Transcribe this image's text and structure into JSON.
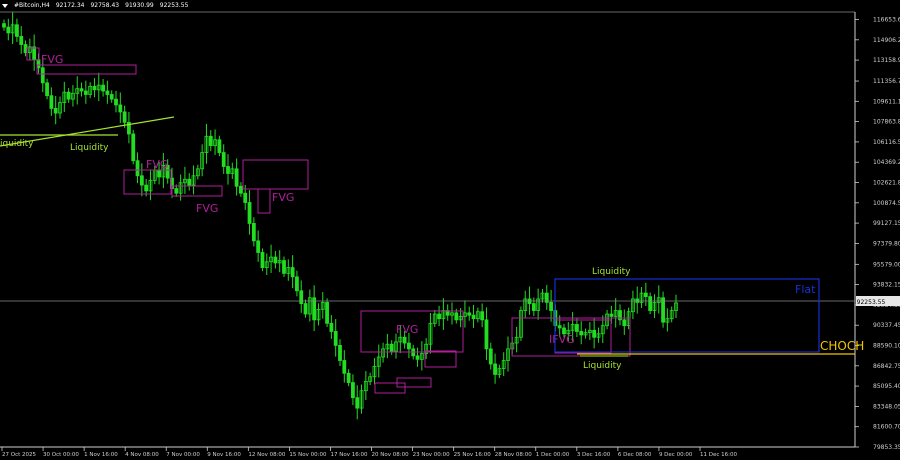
{
  "header": {
    "symbol": "#Bitcoin,H4",
    "open": "92172.34",
    "high": "92758.43",
    "low": "91930.99",
    "close": "92253.55"
  },
  "colors": {
    "background": "#000000",
    "candle": "#22dd22",
    "axis": "#cfcfcf",
    "fvg": "#b0209a",
    "liquidity": "#a6e22e",
    "flat": "#1730d8",
    "choch": "#f2c400",
    "price_line": "#8a8a8a"
  },
  "chart_data": {
    "type": "candlestick",
    "symbol": "#Bitcoin",
    "timeframe": "H4",
    "x_labels": [
      "27 Oct 2025",
      "30 Oct 00:00",
      "1 Nov 16:00",
      "4 Nov 08:00",
      "7 Nov 00:00",
      "9 Nov 16:00",
      "12 Nov 08:00",
      "15 Nov 00:00",
      "17 Nov 16:00",
      "20 Nov 08:00",
      "23 Nov 00:00",
      "25 Nov 16:00",
      "28 Nov 08:00",
      "1 Dec 00:00",
      "3 Dec 16:00",
      "6 Dec 08:00",
      "9 Dec 00:00",
      "11 Dec 16:00"
    ],
    "y_ticks": [
      "116653.60",
      "114906.25",
      "113158.90",
      "111356.70",
      "109611.15",
      "107863.80",
      "106116.55",
      "104369.20",
      "102621.85",
      "100874.50",
      "99127.15",
      "97379.80",
      "95579.00",
      "93832.15",
      "92084.80",
      "90337.45",
      "88590.10",
      "86842.75",
      "85095.40",
      "83348.05",
      "81600.70",
      "79853.35"
    ],
    "ylim": [
      79853.35,
      117300
    ],
    "current_price": "92253.55",
    "close_series": [
      116000,
      115500,
      116200,
      115200,
      114500,
      113800,
      114300,
      113200,
      112500,
      111200,
      110100,
      109000,
      108600,
      109500,
      110400,
      109800,
      110300,
      110700,
      110500,
      110200,
      110900,
      110600,
      111000,
      110500,
      110200,
      109800,
      109300,
      108700,
      107800,
      106800,
      104500,
      103200,
      102400,
      101900,
      102800,
      103700,
      103100,
      104100,
      103000,
      102100,
      101700,
      102600,
      102900,
      102400,
      103200,
      103800,
      105200,
      106600,
      105800,
      106300,
      105200,
      104000,
      103400,
      103800,
      102300,
      101700,
      100900,
      99100,
      97600,
      96600,
      95300,
      95800,
      96200,
      95700,
      95900,
      94800,
      95300,
      94500,
      93300,
      92200,
      91300,
      92700,
      90800,
      91700,
      92300,
      90500,
      89800,
      88600,
      87300,
      86200,
      85400,
      84100,
      83200,
      84700,
      85500,
      85900,
      86800,
      87600,
      88300,
      88700,
      88100,
      88900,
      89300,
      88800,
      88300,
      87700,
      87400,
      87900,
      88700,
      90500,
      91300,
      90900,
      91600,
      91200,
      91400,
      90800,
      91100,
      91400,
      91200,
      90900,
      91500,
      90800,
      88300,
      87000,
      86100,
      86600,
      87300,
      88300,
      88800,
      89300,
      91600,
      92600,
      92200,
      91600,
      92600,
      93100,
      92300,
      91600,
      90300,
      90100,
      89600,
      89900,
      90400,
      89800,
      89500,
      89700,
      89900,
      89300,
      89600,
      90300,
      91300,
      91100,
      91600,
      90800,
      90300,
      91500,
      92600,
      92300,
      93100,
      92800,
      91600,
      92300,
      92700,
      90600,
      90900,
      91600,
      92253.55
    ],
    "annotations": {
      "fvg_label": "FVG",
      "liquidity_label": "Liquidity",
      "ifvg_label": "IFVG",
      "flat_label": "Flat",
      "choch_label": "CHOCH",
      "liquidity_left_label": "iquidity"
    }
  }
}
